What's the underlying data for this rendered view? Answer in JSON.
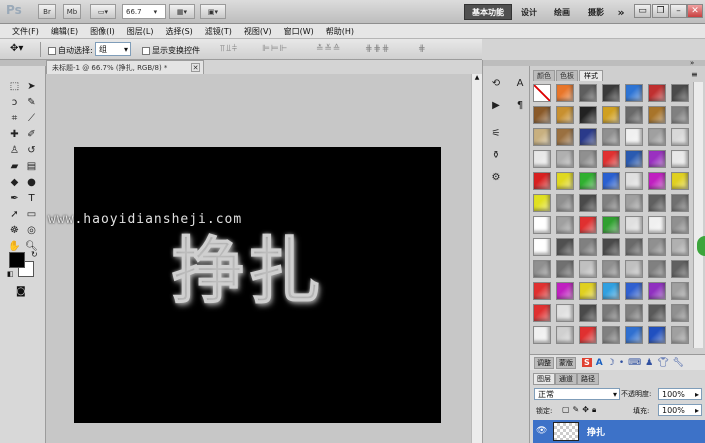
{
  "titlebar": {
    "logo": "Ps",
    "mb_label": "Mb",
    "zoom": "66.7",
    "workspaces": [
      "基本功能",
      "设计",
      "绘画",
      "摄影"
    ],
    "overflow": "»"
  },
  "menu": [
    "文件(F)",
    "编辑(E)",
    "图像(I)",
    "图层(L)",
    "选择(S)",
    "滤镜(T)",
    "视图(V)",
    "窗口(W)",
    "帮助(H)"
  ],
  "options": {
    "auto_select_label": "自动选择:",
    "auto_select_value": "组",
    "show_transform_label": "显示变换控件"
  },
  "document": {
    "tab_title": "未标题-1 @ 66.7% (挣扎, RGB/8) *",
    "watermark": "www.haoyidiansheji.com",
    "canvas_text": "挣扎"
  },
  "style_panel": {
    "tabs": [
      "颜色",
      "色板",
      "样式"
    ],
    "active_tab": "样式",
    "swatch_colors": [
      [
        "#ffffff",
        "#e8762a",
        "#5e5e5e",
        "#3a3a3a",
        "#2e74d4",
        "#c03030",
        "#4a4a4a"
      ],
      [
        "#8a5a2a",
        "#c89030",
        "#222222",
        "#d0a020",
        "#6a6a6a",
        "#a8742a",
        "#808080"
      ],
      [
        "#c8b080",
        "#9a7040",
        "#2a3a8a",
        "#909090",
        "#f0f0f0",
        "#a0a0a0",
        "#d8d8d8"
      ],
      [
        "#e8e8e8",
        "#b0b0b0",
        "#909090",
        "#e03030",
        "#2a5ab0",
        "#9a30c0",
        "#e8e8e8"
      ],
      [
        "#d82020",
        "#e0d820",
        "#30b030",
        "#2a60d0",
        "#e0e0e0",
        "#c020c0",
        "#e0d020"
      ],
      [
        "#e0e020",
        "#909090",
        "#4a4a4a",
        "#808080",
        "#a0a0a0",
        "#606060",
        "#707070"
      ],
      [
        "#ffffff",
        "#a0a0a0",
        "#e03030",
        "#30a030",
        "#e0e0e0",
        "#f0f0f0",
        "#909090"
      ],
      [
        "#ffffff",
        "#505050",
        "#808080",
        "#4a4a4a",
        "#6a6a6a",
        "#909090",
        "#b0b0b0"
      ],
      [
        "#909090",
        "#707070",
        "#c0c0c0",
        "#909090",
        "#c0c0c0",
        "#808080",
        "#606060"
      ],
      [
        "#e03030",
        "#c020c0",
        "#e0d020",
        "#30a0e0",
        "#3060d0",
        "#9030c0",
        "#a0a0a0"
      ],
      [
        "#e03030",
        "#e0e0e0",
        "#4a4a4a",
        "#7a7a7a",
        "#808080",
        "#5a5a5a",
        "#909090"
      ],
      [
        "#f0f0f0",
        "#d0d0d0",
        "#e03030",
        "#808080",
        "#3070d0",
        "#2050c0",
        "#a0a0a0"
      ]
    ]
  },
  "adjust_tabs": [
    "调整",
    "蒙版"
  ],
  "layers": {
    "tabs": [
      "图层",
      "通道",
      "路径"
    ],
    "blend_mode": "正常",
    "opacity_label": "不透明度:",
    "opacity": "100%",
    "lock_label": "锁定:",
    "fill_label": "填充:",
    "fill": "100%",
    "layer_name": "挣扎"
  }
}
